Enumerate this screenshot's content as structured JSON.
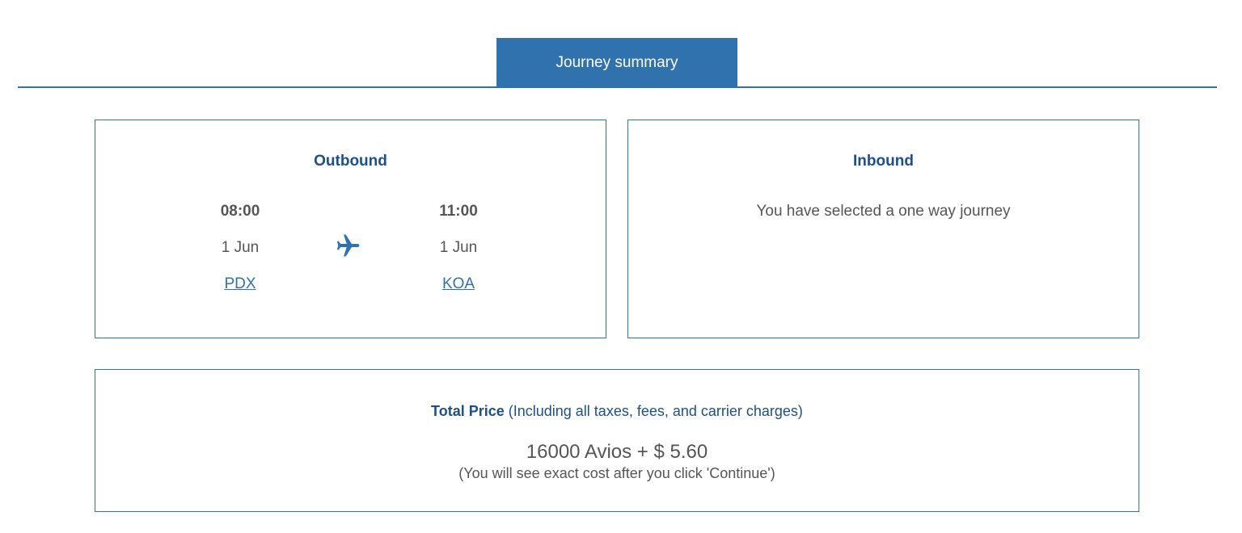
{
  "tab": {
    "label": "Journey summary"
  },
  "outbound": {
    "title": "Outbound",
    "departure": {
      "time": "08:00",
      "date": "1 Jun",
      "airport": "PDX"
    },
    "arrival": {
      "time": "11:00",
      "date": "1 Jun",
      "airport": "KOA"
    },
    "icon": "plane-icon"
  },
  "inbound": {
    "title": "Inbound",
    "message": "You have selected a one way journey"
  },
  "price": {
    "heading_bold": "Total Price",
    "heading_rest": " (Including all taxes, fees, and carrier charges)",
    "amount": "16000 Avios + $ 5.60",
    "note": "(You will see exact cost after you click 'Continue')"
  },
  "colors": {
    "accent": "#2f72ad",
    "heading": "#1d4f8a",
    "text": "#555555"
  }
}
